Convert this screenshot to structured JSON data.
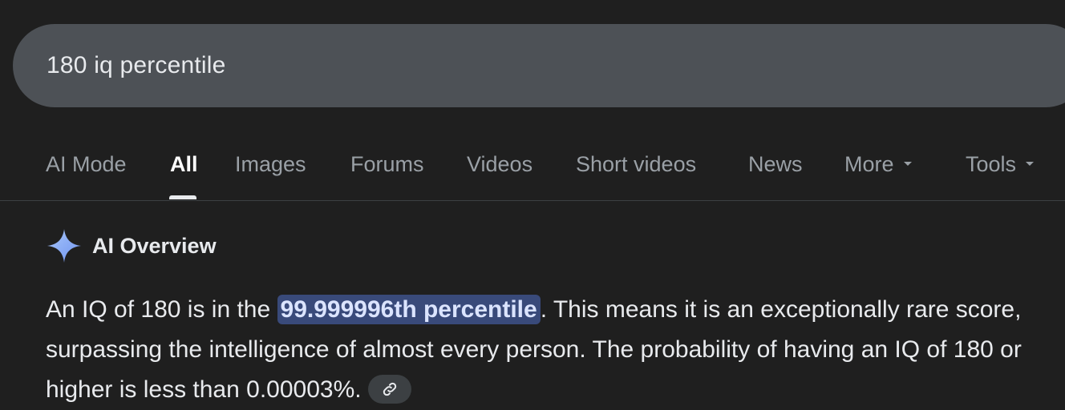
{
  "search": {
    "query": "180 iq percentile"
  },
  "tabs": [
    {
      "label": "AI Mode"
    },
    {
      "label": "All"
    },
    {
      "label": "Images"
    },
    {
      "label": "Forums"
    },
    {
      "label": "Videos"
    },
    {
      "label": "Short videos"
    },
    {
      "label": "News"
    },
    {
      "label": "More"
    },
    {
      "label": "Tools"
    }
  ],
  "active_tab": "All",
  "ai_overview": {
    "title": "AI Overview",
    "icon": "sparkle-icon",
    "text_before": "An IQ of 180 is in the ",
    "highlight": "99.999996th percentile",
    "text_after": ". This means it is an exceptionally rare score, surpassing the intelligence of almost every person. The probability of having an IQ of 180 or higher is less than 0.00003%.",
    "link_icon": "link-icon"
  },
  "colors": {
    "background": "#1f1f1f",
    "search_bar": "#4d5156",
    "highlight_bg": "#394a7a",
    "sparkle": "#8ab4f8"
  }
}
